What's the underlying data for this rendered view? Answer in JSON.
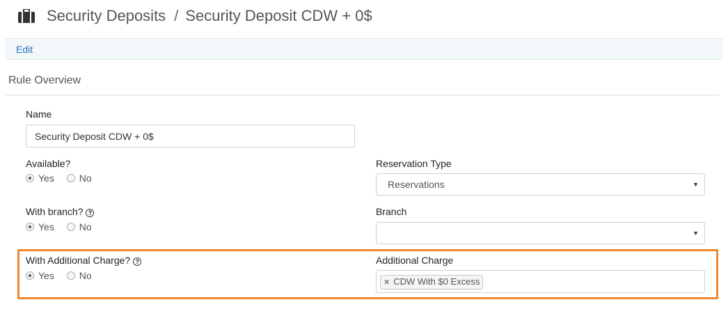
{
  "header": {
    "icon": "briefcase-icon",
    "breadcrumb_parent": "Security Deposits",
    "separator": "/",
    "breadcrumb_current": "Security Deposit CDW + 0$"
  },
  "toolbar": {
    "edit_label": "Edit"
  },
  "section": {
    "title": "Rule Overview"
  },
  "form": {
    "name_label": "Name",
    "name_value": "Security Deposit CDW + 0$",
    "available_label": "Available?",
    "available_yes": "Yes",
    "available_no": "No",
    "available_selected": "Yes",
    "with_branch_label": "With branch?",
    "with_branch_yes": "Yes",
    "with_branch_no": "No",
    "with_branch_selected": "Yes",
    "with_additional_charge_label": "With Additional Charge?",
    "with_additional_charge_yes": "Yes",
    "with_additional_charge_no": "No",
    "with_additional_charge_selected": "Yes",
    "reservation_type_label": "Reservation Type",
    "reservation_type_value": "Reservations",
    "branch_label": "Branch",
    "branch_value": "",
    "additional_charge_label": "Additional Charge",
    "additional_charge_tags": [
      "CDW With $0 Excess"
    ],
    "help_icon": "question-circle-icon",
    "dropdown_icon": "caret-down-icon",
    "highlight_color": "#f0842a"
  }
}
